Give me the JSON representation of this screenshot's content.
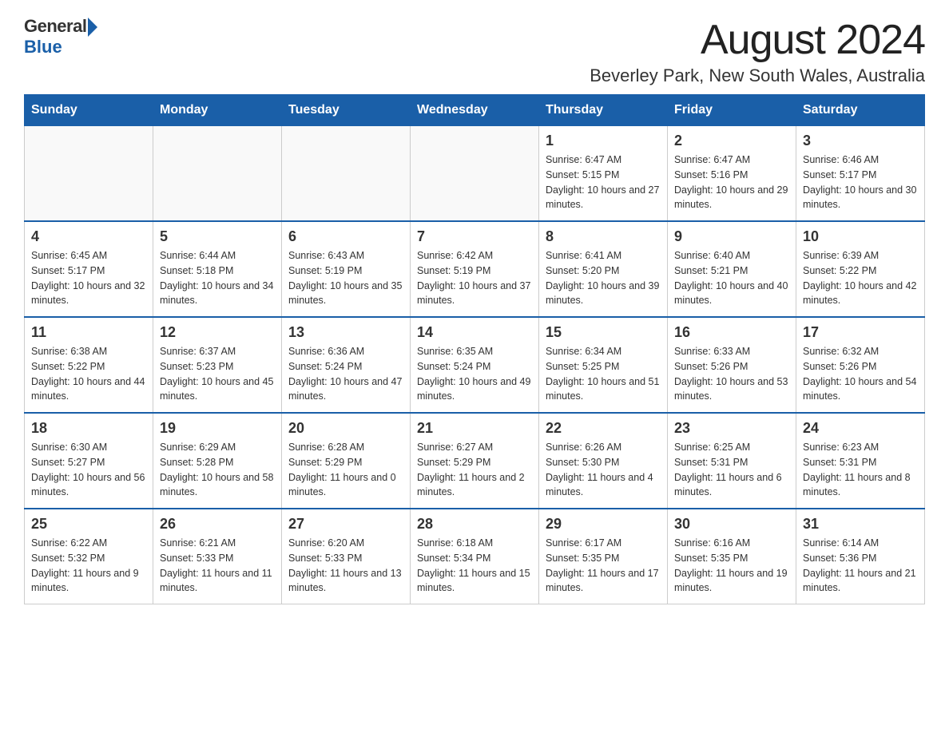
{
  "logo": {
    "general": "General",
    "blue": "Blue"
  },
  "title": "August 2024",
  "location": "Beverley Park, New South Wales, Australia",
  "weekdays": [
    "Sunday",
    "Monday",
    "Tuesday",
    "Wednesday",
    "Thursday",
    "Friday",
    "Saturday"
  ],
  "weeks": [
    [
      {
        "day": "",
        "info": ""
      },
      {
        "day": "",
        "info": ""
      },
      {
        "day": "",
        "info": ""
      },
      {
        "day": "",
        "info": ""
      },
      {
        "day": "1",
        "info": "Sunrise: 6:47 AM\nSunset: 5:15 PM\nDaylight: 10 hours and 27 minutes."
      },
      {
        "day": "2",
        "info": "Sunrise: 6:47 AM\nSunset: 5:16 PM\nDaylight: 10 hours and 29 minutes."
      },
      {
        "day": "3",
        "info": "Sunrise: 6:46 AM\nSunset: 5:17 PM\nDaylight: 10 hours and 30 minutes."
      }
    ],
    [
      {
        "day": "4",
        "info": "Sunrise: 6:45 AM\nSunset: 5:17 PM\nDaylight: 10 hours and 32 minutes."
      },
      {
        "day": "5",
        "info": "Sunrise: 6:44 AM\nSunset: 5:18 PM\nDaylight: 10 hours and 34 minutes."
      },
      {
        "day": "6",
        "info": "Sunrise: 6:43 AM\nSunset: 5:19 PM\nDaylight: 10 hours and 35 minutes."
      },
      {
        "day": "7",
        "info": "Sunrise: 6:42 AM\nSunset: 5:19 PM\nDaylight: 10 hours and 37 minutes."
      },
      {
        "day": "8",
        "info": "Sunrise: 6:41 AM\nSunset: 5:20 PM\nDaylight: 10 hours and 39 minutes."
      },
      {
        "day": "9",
        "info": "Sunrise: 6:40 AM\nSunset: 5:21 PM\nDaylight: 10 hours and 40 minutes."
      },
      {
        "day": "10",
        "info": "Sunrise: 6:39 AM\nSunset: 5:22 PM\nDaylight: 10 hours and 42 minutes."
      }
    ],
    [
      {
        "day": "11",
        "info": "Sunrise: 6:38 AM\nSunset: 5:22 PM\nDaylight: 10 hours and 44 minutes."
      },
      {
        "day": "12",
        "info": "Sunrise: 6:37 AM\nSunset: 5:23 PM\nDaylight: 10 hours and 45 minutes."
      },
      {
        "day": "13",
        "info": "Sunrise: 6:36 AM\nSunset: 5:24 PM\nDaylight: 10 hours and 47 minutes."
      },
      {
        "day": "14",
        "info": "Sunrise: 6:35 AM\nSunset: 5:24 PM\nDaylight: 10 hours and 49 minutes."
      },
      {
        "day": "15",
        "info": "Sunrise: 6:34 AM\nSunset: 5:25 PM\nDaylight: 10 hours and 51 minutes."
      },
      {
        "day": "16",
        "info": "Sunrise: 6:33 AM\nSunset: 5:26 PM\nDaylight: 10 hours and 53 minutes."
      },
      {
        "day": "17",
        "info": "Sunrise: 6:32 AM\nSunset: 5:26 PM\nDaylight: 10 hours and 54 minutes."
      }
    ],
    [
      {
        "day": "18",
        "info": "Sunrise: 6:30 AM\nSunset: 5:27 PM\nDaylight: 10 hours and 56 minutes."
      },
      {
        "day": "19",
        "info": "Sunrise: 6:29 AM\nSunset: 5:28 PM\nDaylight: 10 hours and 58 minutes."
      },
      {
        "day": "20",
        "info": "Sunrise: 6:28 AM\nSunset: 5:29 PM\nDaylight: 11 hours and 0 minutes."
      },
      {
        "day": "21",
        "info": "Sunrise: 6:27 AM\nSunset: 5:29 PM\nDaylight: 11 hours and 2 minutes."
      },
      {
        "day": "22",
        "info": "Sunrise: 6:26 AM\nSunset: 5:30 PM\nDaylight: 11 hours and 4 minutes."
      },
      {
        "day": "23",
        "info": "Sunrise: 6:25 AM\nSunset: 5:31 PM\nDaylight: 11 hours and 6 minutes."
      },
      {
        "day": "24",
        "info": "Sunrise: 6:23 AM\nSunset: 5:31 PM\nDaylight: 11 hours and 8 minutes."
      }
    ],
    [
      {
        "day": "25",
        "info": "Sunrise: 6:22 AM\nSunset: 5:32 PM\nDaylight: 11 hours and 9 minutes."
      },
      {
        "day": "26",
        "info": "Sunrise: 6:21 AM\nSunset: 5:33 PM\nDaylight: 11 hours and 11 minutes."
      },
      {
        "day": "27",
        "info": "Sunrise: 6:20 AM\nSunset: 5:33 PM\nDaylight: 11 hours and 13 minutes."
      },
      {
        "day": "28",
        "info": "Sunrise: 6:18 AM\nSunset: 5:34 PM\nDaylight: 11 hours and 15 minutes."
      },
      {
        "day": "29",
        "info": "Sunrise: 6:17 AM\nSunset: 5:35 PM\nDaylight: 11 hours and 17 minutes."
      },
      {
        "day": "30",
        "info": "Sunrise: 6:16 AM\nSunset: 5:35 PM\nDaylight: 11 hours and 19 minutes."
      },
      {
        "day": "31",
        "info": "Sunrise: 6:14 AM\nSunset: 5:36 PM\nDaylight: 11 hours and 21 minutes."
      }
    ]
  ]
}
